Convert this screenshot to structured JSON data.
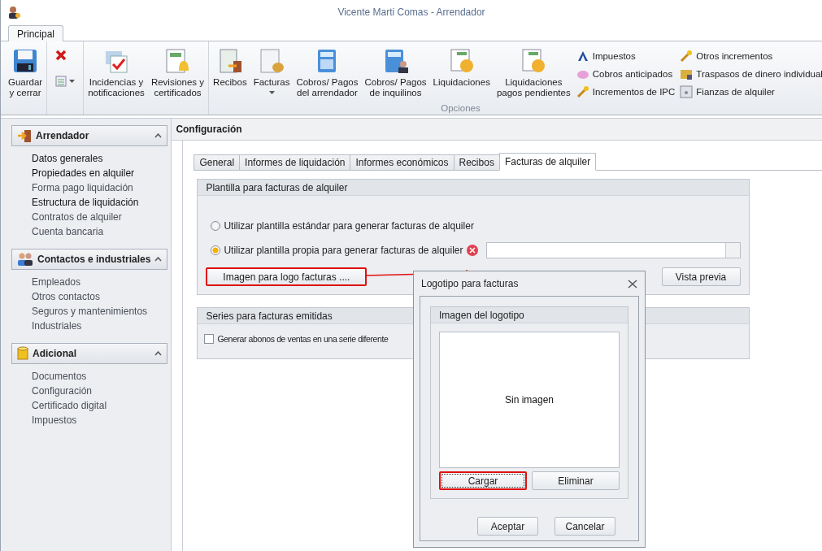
{
  "window": {
    "title": "Vicente Marti Comas - Arrendador"
  },
  "ribbon": {
    "tabs": [
      {
        "label": "Principal",
        "selected": true
      }
    ],
    "groups": [
      {
        "buttons": [
          {
            "label": "Guardar\ny cerrar",
            "dropdown": false
          }
        ]
      },
      {
        "buttons": [
          {
            "label": "Incidencias y\nnotificaciones",
            "dropdown": false
          },
          {
            "label": "Revisiones y\ncertificados",
            "dropdown": false
          }
        ]
      },
      {
        "label": "Opciones",
        "buttons": [
          {
            "label": "Recibos",
            "dropdown": false
          },
          {
            "label": "Facturas",
            "dropdown": true
          },
          {
            "label": "Cobros/ Pagos\ndel arrendador",
            "dropdown": false
          },
          {
            "label": "Cobros/ Pagos\nde inquilinos",
            "dropdown": false
          },
          {
            "label": "Liquidaciones",
            "dropdown": false
          },
          {
            "label": "Liquidaciones\npagos pendientes",
            "dropdown": false
          }
        ],
        "small_buttons": [
          {
            "label": "Impuestos"
          },
          {
            "label": "Cobros anticipados"
          },
          {
            "label": "Incrementos de IPC"
          },
          {
            "label": "Otros incrementos"
          },
          {
            "label": "Traspasos de dinero individual"
          },
          {
            "label": "Fianzas de alquiler"
          }
        ]
      }
    ]
  },
  "sidebar": {
    "sections": [
      {
        "title": "Arrendador",
        "expanded": true,
        "items": [
          {
            "label": "Datos generales",
            "highlighted": true
          },
          {
            "label": "Propiedades en alquiler",
            "highlighted": true
          },
          {
            "label": "Forma pago liquidación",
            "highlighted": false
          },
          {
            "label": "Estructura de liquidación",
            "highlighted": true
          },
          {
            "label": "Contratos de alquiler",
            "highlighted": false
          },
          {
            "label": "Cuenta bancaria",
            "highlighted": false
          }
        ]
      },
      {
        "title": "Contactos e industriales",
        "expanded": true,
        "items": [
          {
            "label": "Empleados",
            "highlighted": false
          },
          {
            "label": "Otros contactos",
            "highlighted": false
          },
          {
            "label": "Seguros y mantenimientos",
            "highlighted": false
          },
          {
            "label": "Industriales",
            "highlighted": false
          }
        ]
      },
      {
        "title": "Adicional",
        "expanded": true,
        "items": [
          {
            "label": "Documentos",
            "highlighted": false
          },
          {
            "label": "Configuración",
            "highlighted": false
          },
          {
            "label": "Certificado digital",
            "highlighted": false
          },
          {
            "label": "Impuestos",
            "highlighted": false
          }
        ]
      }
    ]
  },
  "main": {
    "title": "Configuración",
    "tabs": [
      {
        "label": "General",
        "selected": false
      },
      {
        "label": "Informes de liquidación",
        "selected": false
      },
      {
        "label": "Informes económicos",
        "selected": false
      },
      {
        "label": "Recibos",
        "selected": false
      },
      {
        "label": "Facturas de alquiler",
        "selected": true
      }
    ],
    "template_group": {
      "title": "Plantilla para facturas de alquiler",
      "options": [
        {
          "label": "Utilizar plantilla estándar para generar facturas de alquiler",
          "selected": false
        },
        {
          "label": "Utilizar plantilla propia para generar facturas de alquiler",
          "selected": true
        }
      ],
      "file_field": {
        "error": true
      },
      "logo_button": {
        "label": "Imagen para logo facturas ....",
        "highlighted": true
      },
      "preview_button": {
        "label": "Vista previa"
      }
    },
    "series_group": {
      "title": "Series para facturas emitidas",
      "checkbox": {
        "label": "Generar abonos de ventas en una serie diferente",
        "checked": false
      }
    }
  },
  "dialog": {
    "title": "Logotipo para facturas",
    "group_title": "Imagen del logotipo",
    "image_placeholder": "Sin imagen",
    "buttons": [
      {
        "label": "Cargar",
        "highlighted": true
      },
      {
        "label": "Eliminar",
        "highlighted": false
      }
    ],
    "footer_buttons": [
      {
        "label": "Aceptar"
      },
      {
        "label": "Cancelar"
      }
    ]
  }
}
